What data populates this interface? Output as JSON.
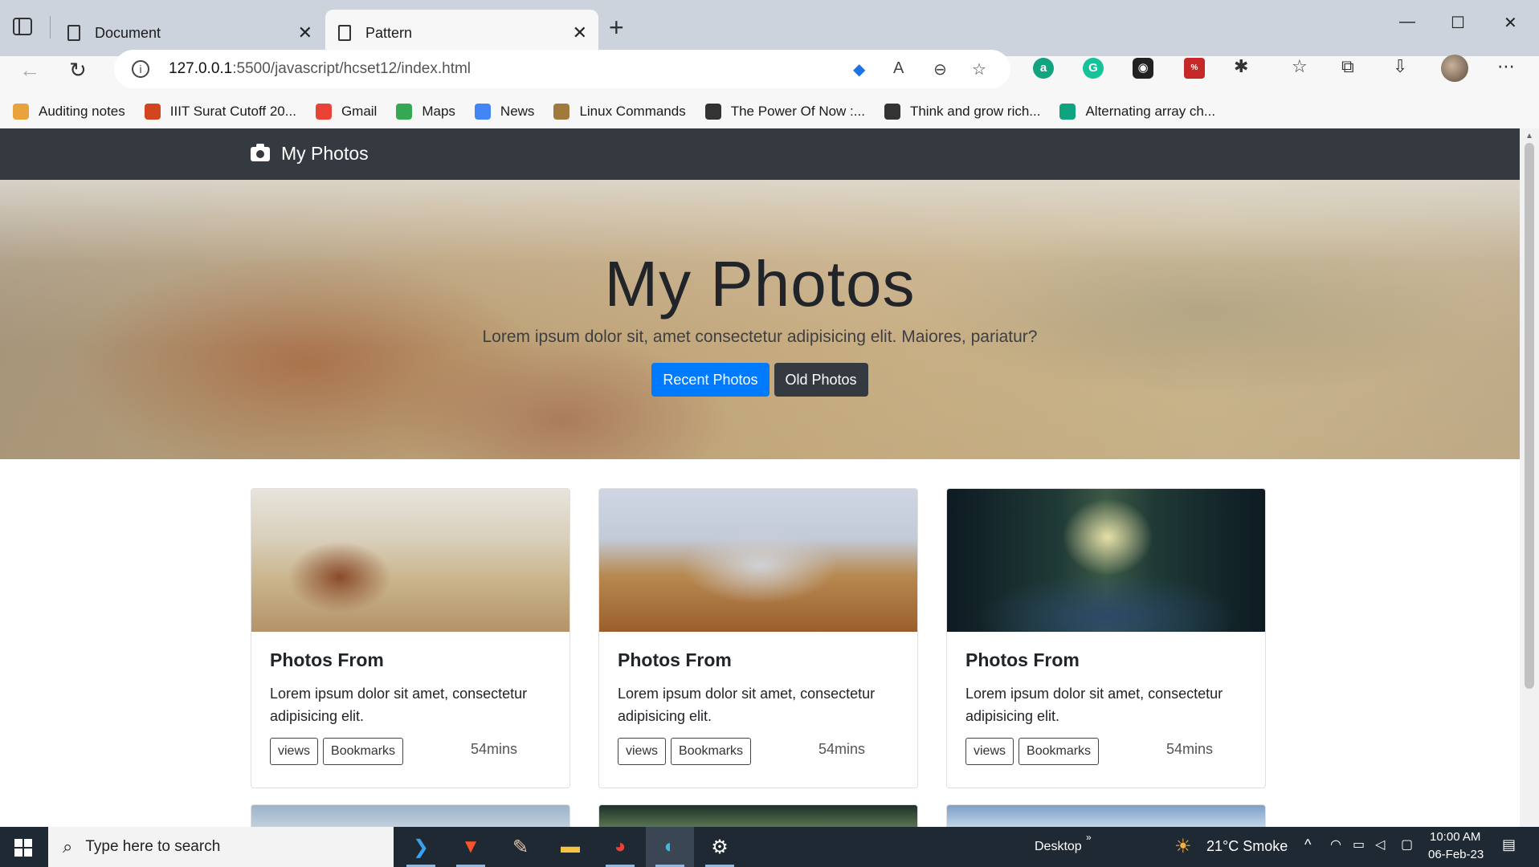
{
  "browser": {
    "tabs": [
      {
        "title": "Document",
        "active": false
      },
      {
        "title": "Pattern",
        "active": true
      }
    ],
    "new_tab": "+",
    "window_controls": {
      "minimize": "—",
      "maximize": "☐",
      "close": "✕"
    },
    "url_host": "127.0.0.1",
    "url_path": ":5500/javascript/hcset12/index.html",
    "bookmarks": [
      {
        "label": "Auditing notes",
        "color": "#e8a33d"
      },
      {
        "label": "IIIT Surat Cutoff 20...",
        "color": "#d2451e"
      },
      {
        "label": "Gmail",
        "color": "#ea4335"
      },
      {
        "label": "Maps",
        "color": "#34a853"
      },
      {
        "label": "News",
        "color": "#4285f4"
      },
      {
        "label": "Linux Commands",
        "color": "#a07a3c"
      },
      {
        "label": "The Power Of Now :...",
        "color": "#333333"
      },
      {
        "label": "Think and grow rich...",
        "color": "#333333"
      },
      {
        "label": "Alternating array ch...",
        "color": "#10a37f"
      }
    ]
  },
  "page": {
    "navbar": {
      "brand": "My Photos"
    },
    "hero": {
      "title": "My Photos",
      "subtitle": "Lorem ipsum dolor sit, amet consectetur adipisicing elit. Maiores, pariatur?",
      "primary_button": "Recent Photos",
      "secondary_button": "Old Photos"
    },
    "cards": [
      {
        "title": "Photos From",
        "text": "Lorem ipsum dolor sit amet, consectetur adipisicing elit.",
        "tag1": "views",
        "tag2": "Bookmarks",
        "time": "54mins"
      },
      {
        "title": "Photos From",
        "text": "Lorem ipsum dolor sit amet, consectetur adipisicing elit.",
        "tag1": "views",
        "tag2": "Bookmarks",
        "time": "54mins"
      },
      {
        "title": "Photos From",
        "text": "Lorem ipsum dolor sit amet, consectetur adipisicing elit.",
        "tag1": "views",
        "tag2": "Bookmarks",
        "time": "54mins"
      }
    ]
  },
  "taskbar": {
    "search_placeholder": "Type here to search",
    "desktop_label": "Desktop",
    "weather": "21°C  Smoke",
    "time": "10:00 AM",
    "date": "06-Feb-23"
  },
  "colors": {
    "navbar": "#343a40",
    "primary": "#007bff",
    "secondary": "#343a40"
  }
}
